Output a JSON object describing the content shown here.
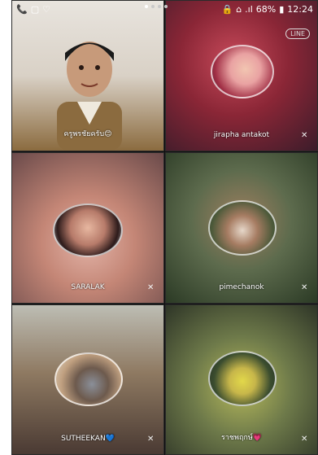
{
  "status_bar": {
    "battery_percent": "68%",
    "time": "12:24",
    "signal_text": ".ıl"
  },
  "call": {
    "brand_badge": "LINE",
    "page_indicator": {
      "pages": 4,
      "active": 1
    },
    "participants": [
      {
        "name": "ครูพรชัยครับ😊",
        "muted": false
      },
      {
        "name": "jirapha antakot",
        "muted": true
      },
      {
        "name": "SARALAK",
        "muted": true
      },
      {
        "name": "pimechanok",
        "muted": true
      },
      {
        "name": "SUTHEEKAN💙",
        "muted": true
      },
      {
        "name": "ราชพฤกษ์💗",
        "muted": true
      }
    ]
  },
  "colors": {
    "screen_bg": "#0f0f10",
    "text": "#ffffff"
  }
}
